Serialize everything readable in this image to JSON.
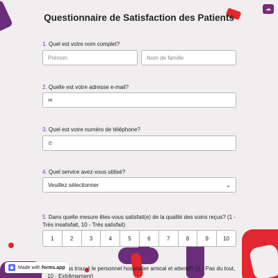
{
  "title": "Questionnaire de Satisfaction des Patients",
  "questions": [
    {
      "num": "1.",
      "text": "Quel est votre nom complet?",
      "fields": [
        {
          "placeholder": "Prénom"
        },
        {
          "placeholder": "Nom de famille"
        }
      ]
    },
    {
      "num": "2.",
      "text": "Quelle est votre adresse e-mail?",
      "icon": "email-icon"
    },
    {
      "num": "3.",
      "text": "Quel est votre numéro de téléphone?",
      "icon": "phone-icon"
    },
    {
      "num": "4.",
      "text": "Quel service avez-vous utilisé?",
      "select_value": "Veuillez sélectionner"
    },
    {
      "num": "5.",
      "text": "Dans quelle mesure êtes-vous satisfait(e) de la qualité des soins reçus? (1 - Très insatisfait, 10 - Très satisfait)",
      "options": [
        "1",
        "2",
        "3",
        "4",
        "5",
        "6",
        "7",
        "8",
        "9",
        "10"
      ]
    },
    {
      "text_visible": "Avez-vous trouvé le personnel hospitalier amical et attentif? (1 - Pas du tout, 10 - Extrêmement)"
    }
  ],
  "badge": {
    "prefix": "Made with",
    "brand": "forms.app"
  },
  "colors": {
    "accent_purple": "#6b2c7a",
    "accent_red": "#e3272f",
    "question_number": "#6b3fa0"
  }
}
